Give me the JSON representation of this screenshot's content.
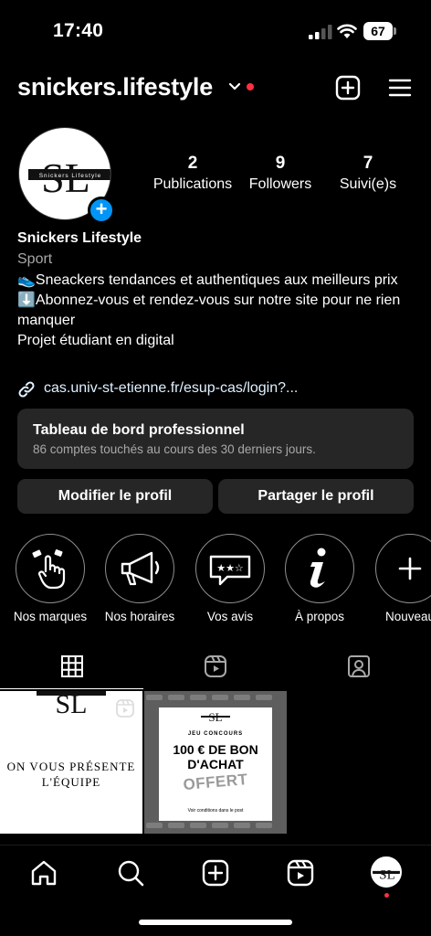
{
  "status_bar": {
    "time": "17:40",
    "battery": "67"
  },
  "header": {
    "username": "snickers.lifestyle"
  },
  "profile": {
    "avatar_text": "SL",
    "avatar_banner": "Snickers Lifestyle",
    "stats": [
      {
        "num": "2",
        "label": "Publications"
      },
      {
        "num": "9",
        "label": "Followers"
      },
      {
        "num": "7",
        "label": "Suivi(e)s"
      }
    ],
    "full_name": "Snickers Lifestyle",
    "category": "Sport",
    "bio": [
      "👟Sneackers tendances et authentiques aux meilleurs prix",
      "⬇️Abonnez-vous et rendez-vous sur notre site pour ne rien manquer",
      "Projet étudiant en digital"
    ],
    "link": "cas.univ-st-etienne.fr/esup-cas/login?..."
  },
  "dashboard": {
    "title": "Tableau de bord professionnel",
    "subtitle": "86 comptes touchés au cours des 30 derniers jours."
  },
  "buttons": {
    "edit": "Modifier le profil",
    "share": "Partager le profil"
  },
  "highlights": [
    {
      "label": "Nos marques",
      "icon": "hand-pointing-icon"
    },
    {
      "label": "Nos horaires",
      "icon": "megaphone-icon"
    },
    {
      "label": "Vos avis",
      "icon": "rating-stars-icon"
    },
    {
      "label": "À propos",
      "icon": "info-icon"
    },
    {
      "label": "Nouveau",
      "icon": "plus-icon"
    }
  ],
  "posts": [
    {
      "title": "ON VOUS PRÉSENTE L'ÉQUIPE",
      "logo": "SL"
    },
    {
      "logo": "SL",
      "kicker": "JEU CONCOURS",
      "main": "100 € DE BON D'ACHAT",
      "offer": "OFFERT",
      "small": "Voir conditions dans le post"
    }
  ],
  "colors": {
    "accent": "#0095f6",
    "notification": "#ff3040",
    "surface": "#262626",
    "muted": "#a8a8a8"
  }
}
